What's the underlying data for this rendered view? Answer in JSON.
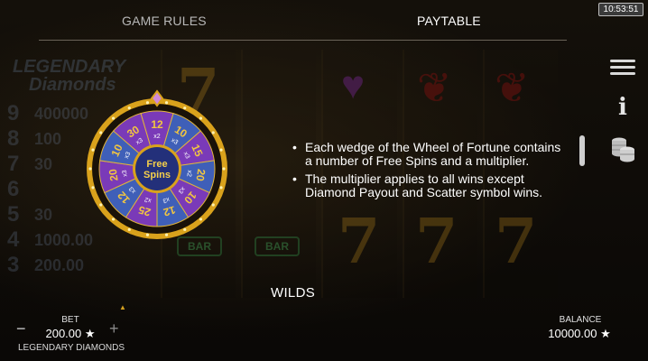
{
  "header": {
    "tabs": [
      {
        "label": "GAME RULES",
        "active": false
      },
      {
        "label": "PAYTABLE",
        "active": true
      }
    ],
    "clock": "10:53:51"
  },
  "menu": {
    "icons": [
      "hamburger-icon",
      "info-icon",
      "coins-icon"
    ],
    "info_glyph": "i"
  },
  "wheel": {
    "center_label_1": "Free",
    "center_label_2": "Spins",
    "wedges": [
      {
        "spins": "12",
        "mult": "x2"
      },
      {
        "spins": "10",
        "mult": "x3"
      },
      {
        "spins": "15",
        "mult": "x3"
      },
      {
        "spins": "20",
        "mult": "x2"
      },
      {
        "spins": "10",
        "mult": "x3"
      },
      {
        "spins": "12",
        "mult": "x3"
      },
      {
        "spins": "25",
        "mult": "x2"
      },
      {
        "spins": "12",
        "mult": "x3"
      },
      {
        "spins": "20",
        "mult": "x3"
      },
      {
        "spins": "10",
        "mult": "x3"
      },
      {
        "spins": "30",
        "mult": "x3"
      }
    ]
  },
  "content": {
    "bullets": [
      "Each wedge of the Wheel of Fortune contains a number of Free Spins and a multiplier.",
      "The multiplier applies to all wins except Diamond Payout and Scatter symbol wins."
    ],
    "section_heading": "WILDS"
  },
  "background": {
    "logo_line1": "LEGENDARY",
    "logo_line2": "Diamonds",
    "pay_rows": [
      {
        "count": "9",
        "value": "400000"
      },
      {
        "count": "8",
        "value": "100"
      },
      {
        "count": "7",
        "value": "30"
      },
      {
        "count": "6",
        "value": ""
      },
      {
        "count": "5",
        "value": "30"
      },
      {
        "count": "4",
        "value": "1000.00"
      },
      {
        "count": "3",
        "value": "200.00"
      }
    ],
    "bar_label": "BAR"
  },
  "footer": {
    "bet_label": "BET",
    "bet_value": "200.00 ★",
    "minus": "−",
    "plus": "+",
    "game_name": "LEGENDARY DIAMONDS",
    "balance_label": "BALANCE",
    "balance_value": "10000.00 ★"
  },
  "colors": {
    "wheel_blue": "#3f5fb8",
    "wheel_purple": "#7a3ab8",
    "wheel_gold": "#d9a21c",
    "background": "#0b0907"
  }
}
